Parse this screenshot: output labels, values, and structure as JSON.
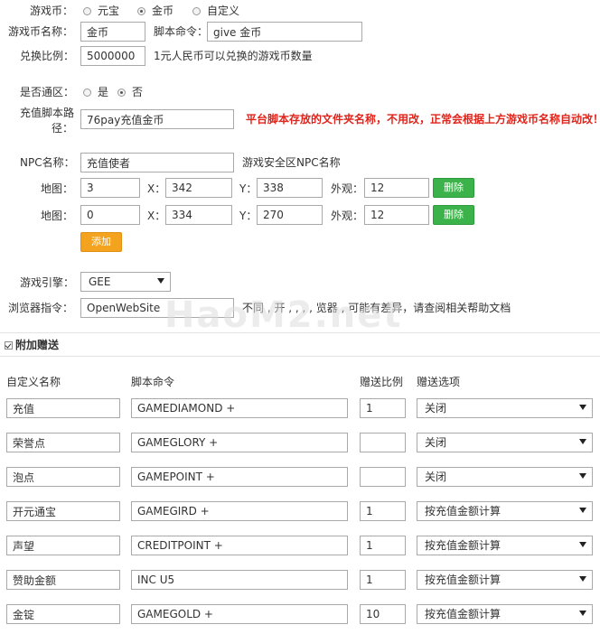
{
  "currency": {
    "label": "游戏币：",
    "options": [
      "元宝",
      "金币",
      "自定义"
    ],
    "selected": "金币"
  },
  "currency_name": {
    "label": "游戏币名称：",
    "value": "金币"
  },
  "script_cmd": {
    "label": "脚本命令：",
    "value": "give 金币"
  },
  "exchange": {
    "label": "兑换比例：",
    "value": "5000000",
    "hint": "1元人民币可以兑换的游戏币数量"
  },
  "universal": {
    "label": "是否通区：",
    "options": [
      "是",
      "否"
    ],
    "selected": "否"
  },
  "script_path": {
    "label_line1": "充值脚本路",
    "label_line2": "径：",
    "value": "76pay充值金币",
    "note": "平台脚本存放的文件夹名称，不用改，正常会根据上方游戏币名称自动改！"
  },
  "npc": {
    "label": "NPC名称：",
    "value": "充值使者",
    "hint": "游戏安全区NPC名称"
  },
  "maps": [
    {
      "label": "地图：",
      "map": "3",
      "x_label": "X：",
      "x": "342",
      "y_label": "Y：",
      "y": "338",
      "look_label": "外观：",
      "look": "12",
      "delete_label": "删除"
    },
    {
      "label": "地图：",
      "map": "0",
      "x_label": "X：",
      "x": "334",
      "y_label": "Y：",
      "y": "270",
      "look_label": "外观：",
      "look": "12",
      "delete_label": "删除"
    }
  ],
  "add_label": "添加",
  "engine": {
    "label": "游戏引擎：",
    "value": "GEE"
  },
  "browser": {
    "label": "浏览器指令：",
    "value": "OpenWebSite",
    "hint": "不同      ,  开 ,  ,  ,  ,  览器       ,  可能有差异，请查阅相关帮助文档"
  },
  "watermark": "HaoM2.net",
  "extra": {
    "label": "附加赠送",
    "checked": true,
    "headers": {
      "name": "自定义名称",
      "cmd": "脚本命令",
      "ratio": "赠送比例",
      "option": "赠送选项"
    },
    "rows": [
      {
        "name": "充值",
        "cmd": "GAMEDIAMOND +",
        "ratio": "1",
        "option": "关闭"
      },
      {
        "name": "荣誉点",
        "cmd": "GAMEGLORY +",
        "ratio": "",
        "option": "关闭"
      },
      {
        "name": "泡点",
        "cmd": "GAMEPOINT +",
        "ratio": "",
        "option": "关闭"
      },
      {
        "name": "开元通宝",
        "cmd": "GAMEGIRD +",
        "ratio": "1",
        "option": "按充值金额计算"
      },
      {
        "name": "声望",
        "cmd": "CREDITPOINT +",
        "ratio": "1",
        "option": "按充值金额计算"
      },
      {
        "name": "赞助金额",
        "cmd": "INC U5",
        "ratio": "1",
        "option": "按充值金额计算"
      },
      {
        "name": "金锭",
        "cmd": "GAMEGOLD +",
        "ratio": "10",
        "option": "按充值金额计算"
      }
    ]
  },
  "colors": {
    "note_red": "#e0241b",
    "green": "#3cb34a",
    "orange": "#f4a31f"
  }
}
